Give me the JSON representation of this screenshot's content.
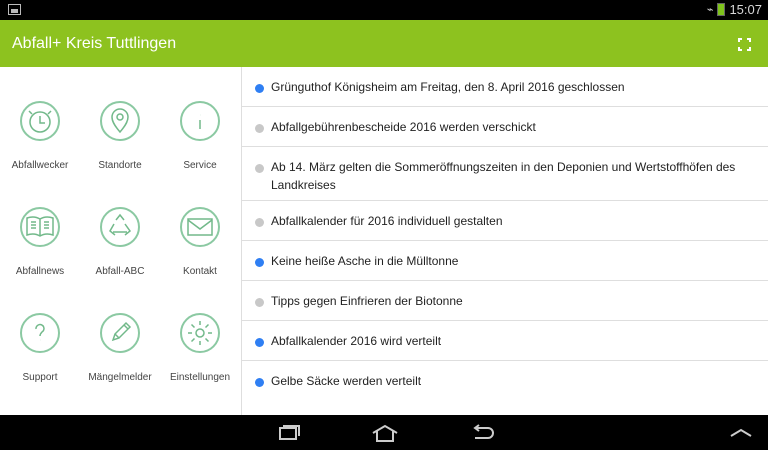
{
  "status_bar": {
    "time": "15:07",
    "icons": [
      "image-icon",
      "signal-icon",
      "battery-icon"
    ]
  },
  "app_bar": {
    "title": "Abfall+ Kreis Tuttlingen",
    "action_icon": "fullscreen-icon"
  },
  "menu": {
    "items": [
      {
        "label": "Abfallwecker",
        "icon": "alarm-clock-icon"
      },
      {
        "label": "Standorte",
        "icon": "location-pin-icon"
      },
      {
        "label": "Service",
        "icon": "info-icon"
      },
      {
        "label": "Abfallnews",
        "icon": "book-icon"
      },
      {
        "label": "Abfall-ABC",
        "icon": "recycle-icon"
      },
      {
        "label": "Kontakt",
        "icon": "envelope-icon"
      },
      {
        "label": "Support",
        "icon": "question-icon"
      },
      {
        "label": "Mängelmelder",
        "icon": "pencil-icon"
      },
      {
        "label": "Einstellungen",
        "icon": "gear-icon"
      }
    ]
  },
  "news": {
    "items": [
      {
        "text": "Grünguthof Königsheim am Freitag, den 8. April 2016 geschlossen",
        "status": "unread"
      },
      {
        "text": "Abfallgebührenbescheide 2016 werden verschickt",
        "status": "read"
      },
      {
        "text": "Ab 14. März gelten die Sommeröffnungszeiten in den Deponien und Wertstoffhöfen des Landkreises",
        "status": "read"
      },
      {
        "text": "Abfallkalender für 2016 individuell gestalten",
        "status": "read"
      },
      {
        "text": "Keine heiße Asche in die Mülltonne",
        "status": "unread"
      },
      {
        "text": "Tipps gegen Einfrieren der Biotonne",
        "status": "read"
      },
      {
        "text": "Abfallkalender 2016 wird verteilt",
        "status": "unread"
      },
      {
        "text": "Gelbe Säcke werden verteilt",
        "status": "unread"
      }
    ]
  },
  "colors": {
    "brand_green": "#8dc21f",
    "icon_green": "#8bc9a2",
    "unread_dot": "#2f7ff3",
    "read_dot": "#c8c8c8"
  },
  "navigation": {
    "icons": [
      "recent-apps-icon",
      "home-icon",
      "back-icon",
      "up-chevron-icon"
    ]
  }
}
